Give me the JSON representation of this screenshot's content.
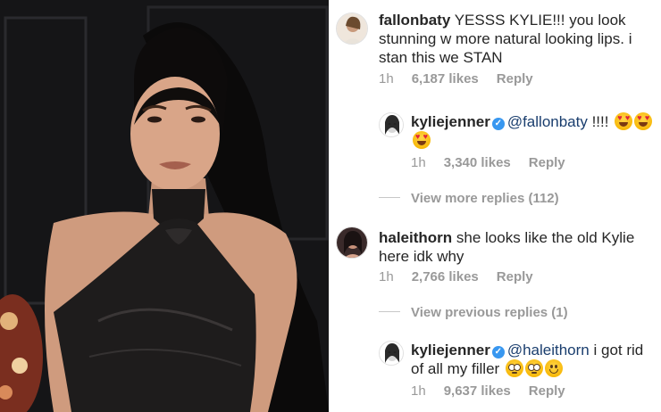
{
  "comments": [
    {
      "username": "fallonbaty",
      "text": " YESSS KYLIE!!! you look stunning w more natural looking lips. i stan this we STAN",
      "time": "1h",
      "likes": "6,187 likes",
      "reply": "Reply",
      "verified": false
    },
    {
      "username": "kyliejenner",
      "mention": "@fallonbaty",
      "text": " !!!!",
      "emojis": [
        "heart-eyes",
        "heart-eyes",
        "heart-eyes"
      ],
      "time": "1h",
      "likes": "3,340 likes",
      "reply": "Reply",
      "verified": true
    },
    {
      "username": "haleithorn",
      "text": " she looks like the old Kylie here idk why",
      "time": "1h",
      "likes": "2,766 likes",
      "reply": "Reply",
      "verified": false
    },
    {
      "username": "kyliejenner",
      "mention": "@haleithorn",
      "text": " i got rid of all my filler ",
      "emojis": [
        "flushed",
        "flushed",
        "smile"
      ],
      "time": "1h",
      "likes": "9,637 likes",
      "reply": "Reply",
      "verified": true
    }
  ],
  "thread_links": {
    "view_more": "View more replies (112)",
    "view_previous": "View previous replies (1)"
  },
  "icons": {
    "verified": "verified-badge-icon"
  },
  "colors": {
    "verified_badge": "#3897f0",
    "mention": "#1a3e6e",
    "meta": "#999999"
  }
}
